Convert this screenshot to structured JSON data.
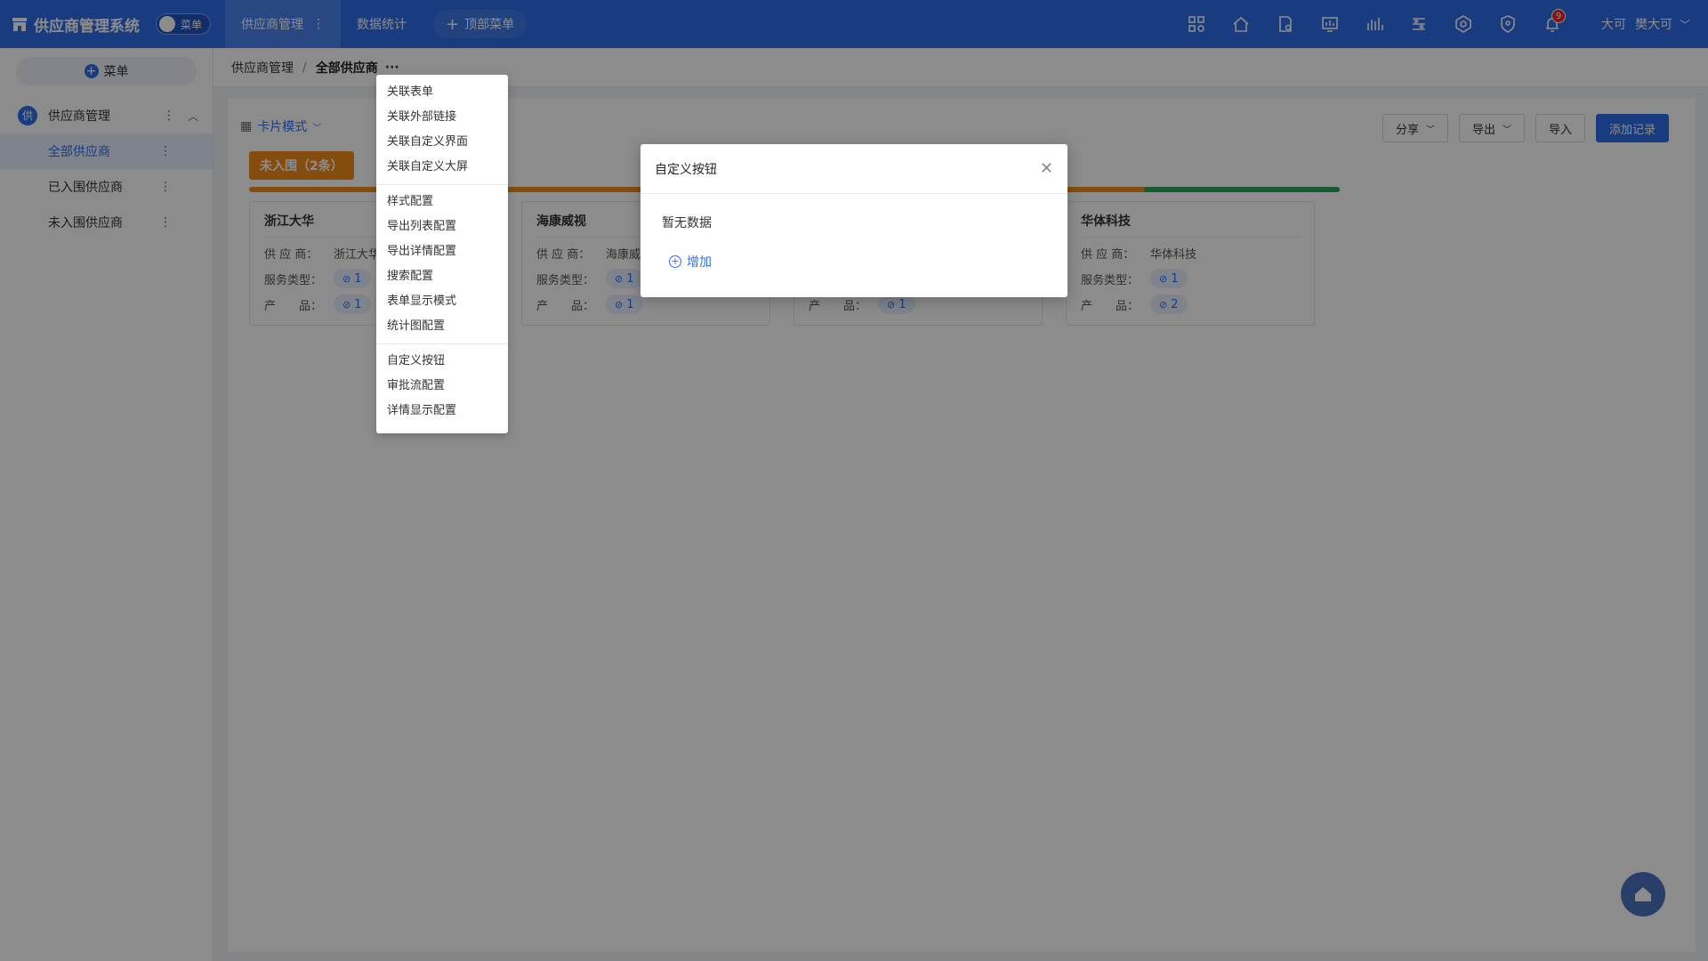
{
  "app": {
    "title": "供应商管理系统",
    "menu_toggle_label": "菜单"
  },
  "topnav": {
    "items": [
      {
        "label": "供应商管理",
        "active": true
      },
      {
        "label": "数据统计",
        "active": false
      }
    ],
    "add_label": "顶部菜单"
  },
  "top_icons": [
    "apps-icon",
    "home-icon",
    "document-settings-icon",
    "dashboard-icon",
    "wave-icon",
    "layers-icon",
    "settings-icon",
    "shield-icon",
    "bell-icon"
  ],
  "notifications": {
    "count": "9"
  },
  "user": {
    "org": "大可",
    "name": "樊大可"
  },
  "sidebar": {
    "add_label": "菜单",
    "group": {
      "icon_text": "供",
      "label": "供应商管理"
    },
    "items": [
      {
        "label": "全部供应商",
        "active": true
      },
      {
        "label": "已入围供应商",
        "active": false
      },
      {
        "label": "未入围供应商",
        "active": false
      }
    ]
  },
  "breadcrumb": {
    "root": "供应商管理",
    "current": "全部供应商",
    "more": "···"
  },
  "toolbar": {
    "view_mode": "卡片模式",
    "share": "分享",
    "export": "导出",
    "import": "导入",
    "add_record": "添加记录"
  },
  "status_tag": "未入围（2条）",
  "cards": [
    {
      "title": "浙江大华",
      "supplier_label": "供 应 商：",
      "supplier": "浙江大华",
      "service_label": "服务类型：",
      "service": "1",
      "product_label": "产　　品：",
      "product": "1"
    },
    {
      "title": "海康威视",
      "supplier_label": "供 应 商：",
      "supplier": "海康威视",
      "service_label": "服务类型：",
      "service": "1",
      "product_label": "产　　品：",
      "product": "1"
    },
    {
      "title": "",
      "supplier_label": "",
      "supplier": "",
      "service_label": "",
      "service": "",
      "product_label": "产　　品：",
      "product": "1"
    },
    {
      "title": "华体科技",
      "supplier_label": "供 应 商：",
      "supplier": "华体科技",
      "service_label": "服务类型：",
      "service": "1",
      "product_label": "产　　品：",
      "product": "2"
    }
  ],
  "colors": {
    "accent": "#2f6ee9",
    "orange": "#f08c1a",
    "green": "#27a55a"
  },
  "dropdown": {
    "group1": [
      "关联表单",
      "关联外部链接",
      "关联自定义界面",
      "关联自定义大屏"
    ],
    "group2": [
      "样式配置",
      "导出列表配置",
      "导出详情配置",
      "搜索配置",
      "表单显示模式",
      "统计图配置"
    ],
    "group3": [
      "自定义按钮",
      "审批流配置",
      "详情显示配置"
    ]
  },
  "modal": {
    "title": "自定义按钮",
    "empty_text": "暂无数据",
    "add_label": "增加"
  }
}
